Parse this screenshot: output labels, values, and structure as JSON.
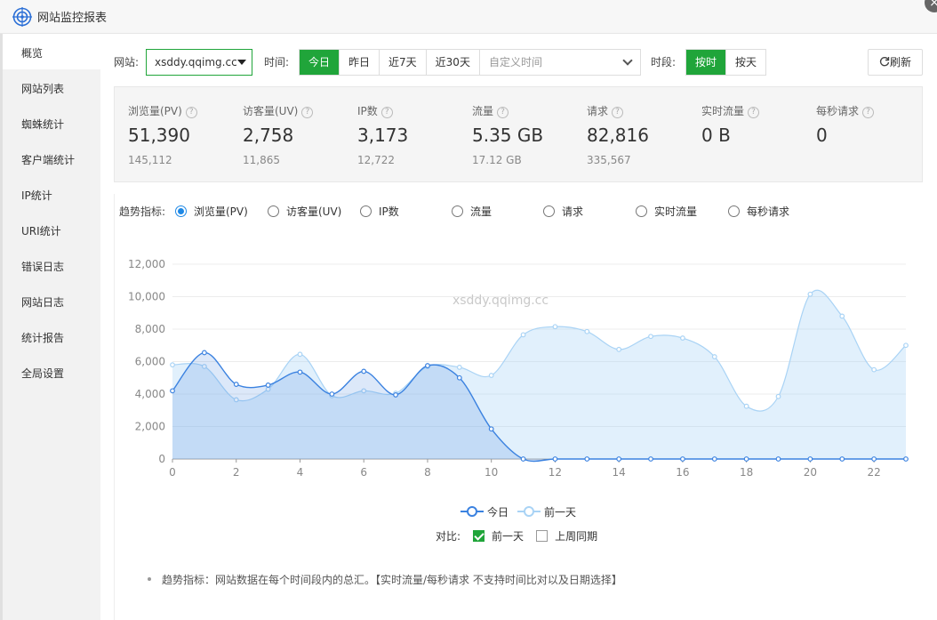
{
  "window": {
    "title": "网站监控报表",
    "close_label": "×"
  },
  "sidebar": {
    "items": [
      {
        "label": "概览",
        "active": true
      },
      {
        "label": "网站列表"
      },
      {
        "label": "蜘蛛统计"
      },
      {
        "label": "客户端统计"
      },
      {
        "label": "IP统计"
      },
      {
        "label": "URI统计"
      },
      {
        "label": "错误日志"
      },
      {
        "label": "网站日志"
      },
      {
        "label": "统计报告"
      },
      {
        "label": "全局设置"
      }
    ]
  },
  "toolbar": {
    "site_label": "网站:",
    "site_value": "xsddy.qqimg.cc",
    "time_label": "时间:",
    "time_buttons": [
      "今日",
      "昨日",
      "近7天",
      "近30天"
    ],
    "time_active": "今日",
    "custom_time_placeholder": "自定义时间",
    "period_label": "时段:",
    "period_buttons": [
      "按时",
      "按天"
    ],
    "period_active": "按时",
    "refresh_label": "刷新"
  },
  "stats": [
    {
      "name": "浏览量(PV)",
      "value": "51,390",
      "sub": "145,112"
    },
    {
      "name": "访客量(UV)",
      "value": "2,758",
      "sub": "11,865"
    },
    {
      "name": "IP数",
      "value": "3,173",
      "sub": "12,722"
    },
    {
      "name": "流量",
      "value": "5.35 GB",
      "sub": "17.12 GB"
    },
    {
      "name": "请求",
      "value": "82,816",
      "sub": "335,567"
    },
    {
      "name": "实时流量",
      "value": "0 B",
      "sub": ""
    },
    {
      "name": "每秒请求",
      "value": "0",
      "sub": ""
    }
  ],
  "trend": {
    "label": "趋势指标:",
    "options": [
      "浏览量(PV)",
      "访客量(UV)",
      "IP数",
      "流量",
      "请求",
      "实时流量",
      "每秒请求"
    ],
    "selected": "浏览量(PV)"
  },
  "chart_data": {
    "type": "area",
    "watermark": "xsddy.qqimg.cc",
    "x": [
      0,
      1,
      2,
      3,
      4,
      5,
      6,
      7,
      8,
      9,
      10,
      11,
      12,
      13,
      14,
      15,
      16,
      17,
      18,
      19,
      20,
      21,
      22,
      23
    ],
    "xticks": [
      0,
      2,
      4,
      6,
      8,
      10,
      12,
      14,
      16,
      18,
      20,
      22
    ],
    "yticks": [
      0,
      2000,
      4000,
      6000,
      8000,
      10000,
      12000
    ],
    "ytick_labels": [
      "0",
      "2,000",
      "4,000",
      "6,000",
      "8,000",
      "10,000",
      "12,000"
    ],
    "ylim": [
      0,
      12000
    ],
    "series": [
      {
        "name": "今日",
        "color": "#3b82e0",
        "values": [
          4200,
          6550,
          4600,
          4550,
          5350,
          4000,
          5400,
          3950,
          5750,
          5000,
          1850,
          0,
          0,
          0,
          0,
          0,
          0,
          0,
          0,
          0,
          0,
          0,
          0,
          0
        ]
      },
      {
        "name": "前一天",
        "color": "#a9d3f5",
        "values": [
          5800,
          5700,
          3650,
          4300,
          6450,
          3900,
          4200,
          4050,
          5700,
          5650,
          5150,
          7650,
          8150,
          7850,
          6750,
          7550,
          7450,
          6300,
          3250,
          3850,
          10150,
          8800,
          5500,
          7000
        ]
      }
    ]
  },
  "compare": {
    "label": "对比:",
    "options": [
      {
        "label": "前一天",
        "checked": true
      },
      {
        "label": "上周同期",
        "checked": false
      }
    ]
  },
  "note": "趋势指标：网站数据在每个时间段内的总汇。【实时流量/每秒请求 不支持时间比对以及日期选择】"
}
